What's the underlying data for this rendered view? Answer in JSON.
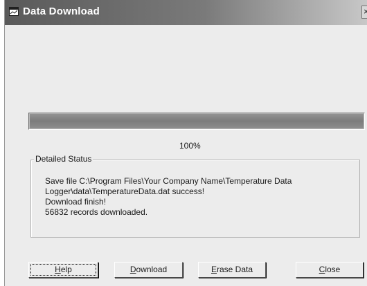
{
  "window": {
    "title": "Data Download",
    "close_glyph": "×",
    "icon": "window-icon"
  },
  "progress": {
    "fraction": 1.0,
    "label": "100%"
  },
  "status_group": {
    "legend": "Detailed Status",
    "lines": [
      "Save file C:\\Program Files\\Your Company Name\\Temperature Data",
      "Logger\\data\\TemperatureData.dat success!",
      "Download finish!",
      "56832 records downloaded."
    ]
  },
  "buttons": {
    "help": {
      "mnemonic": "H",
      "rest": "elp"
    },
    "download": {
      "mnemonic": "D",
      "rest": "ownload"
    },
    "erase": {
      "mnemonic": "E",
      "rest": "rase Data"
    },
    "close": {
      "mnemonic": "C",
      "rest": "lose"
    }
  },
  "colors": {
    "title_bar_start": "#5a5a5a",
    "title_bar_end": "#c8c8c8",
    "dialog_face": "#ececec",
    "progress_fill": "#858585"
  }
}
